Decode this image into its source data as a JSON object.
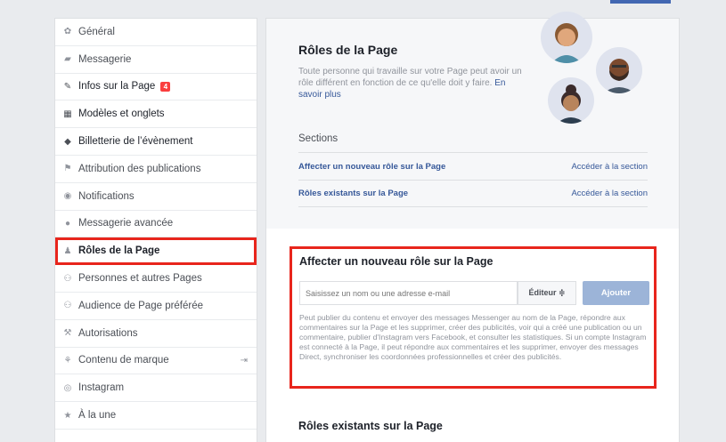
{
  "sidebar": {
    "items": [
      {
        "label": "Général",
        "icon": "gear-icon",
        "glyph": "✿"
      },
      {
        "label": "Messagerie",
        "icon": "message-icon",
        "glyph": "▰"
      },
      {
        "label": "Infos sur la Page",
        "icon": "pencil-icon",
        "glyph": "✎",
        "badge": "4"
      },
      {
        "label": "Modèles et onglets",
        "icon": "grid-icon",
        "glyph": "▦"
      },
      {
        "label": "Billetterie de l’évènement",
        "icon": "ticket-icon",
        "glyph": "◆"
      },
      {
        "label": "Attribution des publications",
        "icon": "flag-icon",
        "glyph": "⚑"
      },
      {
        "label": "Notifications",
        "icon": "globe-icon",
        "glyph": "◉"
      },
      {
        "label": "Messagerie avancée",
        "icon": "chat-icon",
        "glyph": "●"
      },
      {
        "label": "Rôles de la Page",
        "icon": "person-icon",
        "glyph": "♟"
      },
      {
        "label": "Personnes et autres Pages",
        "icon": "people-icon",
        "glyph": "⚇"
      },
      {
        "label": "Audience de Page préférée",
        "icon": "audience-icon",
        "glyph": "⚇"
      },
      {
        "label": "Autorisations",
        "icon": "wrench-icon",
        "glyph": "⚒"
      },
      {
        "label": "Contenu de marque",
        "icon": "handshake-icon",
        "glyph": "⚘"
      },
      {
        "label": "Instagram",
        "icon": "instagram-icon",
        "glyph": "◎"
      },
      {
        "label": "À la une",
        "icon": "star-icon",
        "glyph": "★"
      }
    ]
  },
  "roles": {
    "title": "Rôles de la Page",
    "description": "Toute personne qui travaille sur votre Page peut avoir un rôle différent en fonction de ce qu'elle doit y faire.",
    "learn_more": "En savoir plus",
    "sections_title": "Sections",
    "section_rows": [
      {
        "label": "Affecter un nouveau rôle sur la Page",
        "action": "Accéder à la section"
      },
      {
        "label": "Rôles existants sur la Page",
        "action": "Accéder à la section"
      }
    ]
  },
  "assign": {
    "title": "Affecter un nouveau rôle sur la Page",
    "input_placeholder": "Saisissez un nom ou une adresse e-mail",
    "role_select": "Éditeur ≑",
    "add_button": "Ajouter",
    "help": "Peut publier du contenu et envoyer des messages Messenger au nom de la Page, répondre aux commentaires sur la Page et les supprimer, créer des publicités, voir qui a créé une publication ou un commentaire, publier d'Instagram vers Facebook, et consulter les statistiques. Si un compte Instagram est connecté à la Page, il peut répondre aux commentaires et les supprimer, envoyer des messages Direct, synchroniser les coordonnées professionnelles et créer des publicités."
  },
  "existing": {
    "title": "Rôles existants sur la Page"
  },
  "colors": {
    "accent": "#4267b2",
    "highlight": "#e8251c",
    "link": "#365899"
  }
}
